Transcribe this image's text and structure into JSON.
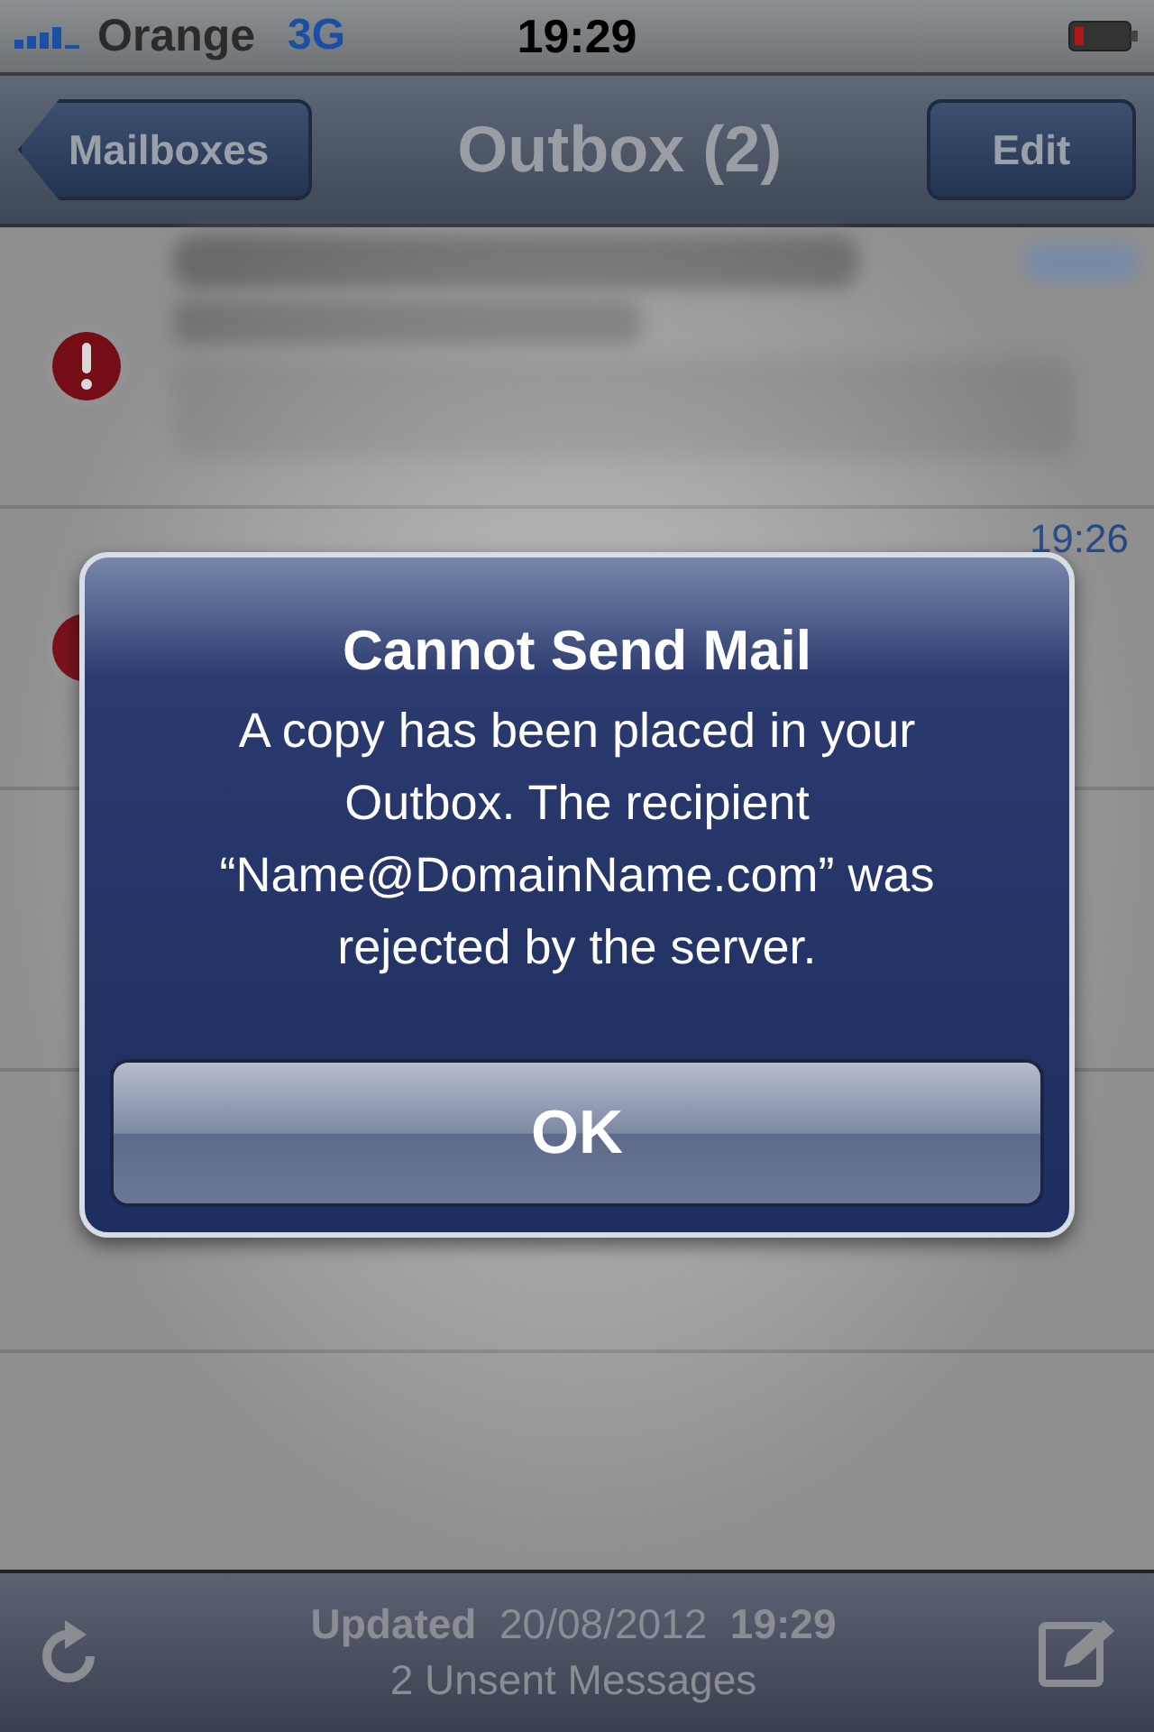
{
  "status_bar": {
    "carrier": "Orange",
    "network": "3G",
    "time": "19:29"
  },
  "nav_bar": {
    "back_button": "Mailboxes",
    "title": "Outbox (2)",
    "edit_button": "Edit"
  },
  "messages": [
    {
      "failed": true,
      "blurred": true
    },
    {
      "failed": true,
      "blurred": false,
      "time": "19:26"
    }
  ],
  "alert": {
    "title": "Cannot Send Mail",
    "message": "A copy has been placed in your Outbox. The recipient “Name@DomainName.com” was rejected by the server.",
    "button": "OK"
  },
  "toolbar": {
    "updated": "**Updated**  20/08/2012  **19:29**",
    "status": "2 Unsent Messages"
  }
}
